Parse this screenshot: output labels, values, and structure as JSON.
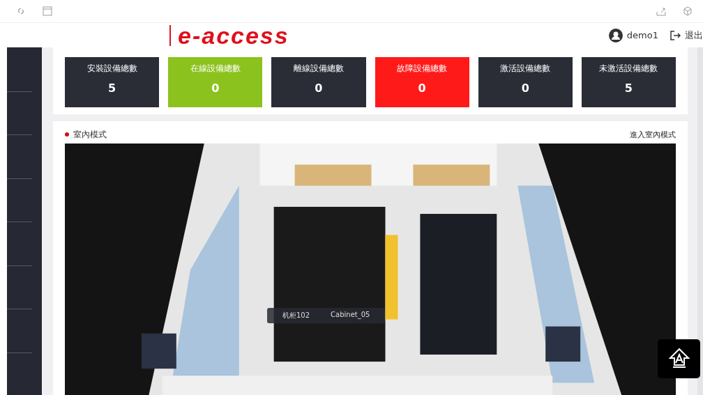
{
  "brand": {
    "logo": "e-access"
  },
  "user": {
    "name": "demo1",
    "logout": "退出"
  },
  "stats": [
    {
      "label": "安裝設備總數",
      "value": "5",
      "color": "#2a2c36"
    },
    {
      "label": "在線設備總數",
      "value": "0",
      "color": "#8cc21d"
    },
    {
      "label": "離線設備總數",
      "value": "0",
      "color": "#2a2c36"
    },
    {
      "label": "故障設備總數",
      "value": "0",
      "color": "#ff1a1a"
    },
    {
      "label": "激活設備總數",
      "value": "0",
      "color": "#2a2c36"
    },
    {
      "label": "未激活設備總數",
      "value": "5",
      "color": "#2a2c36"
    }
  ],
  "indoor": {
    "title": "室內模式",
    "action": "進入室內模式",
    "tooltip": {
      "code": "机柜102",
      "name": "Cabinet_05"
    }
  }
}
